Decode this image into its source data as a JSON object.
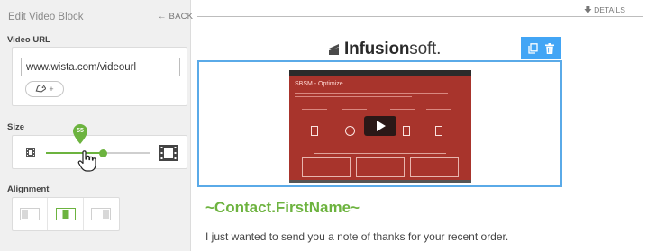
{
  "panel": {
    "title": "Edit Video Block",
    "back_label": "BACK",
    "video_url": {
      "label": "Video URL",
      "value": "www.wista.com/videourl",
      "tag_button_label": "+"
    },
    "size": {
      "label": "Size",
      "slider_value": "55",
      "slider_percent": 0.55
    },
    "alignment": {
      "label": "Alignment",
      "options": [
        "left",
        "center",
        "right"
      ],
      "selected": "center"
    }
  },
  "canvas": {
    "details_label": "DETAILS",
    "logo_text_bold": "Infusion",
    "logo_text_light": "soft.",
    "video": {
      "slide_title": "SBSM - Optimize"
    },
    "headline": "~Contact.FirstName~",
    "body_text": "I just wanted to send you a note of thanks for your recent order."
  },
  "colors": {
    "accent_green": "#6cb33f",
    "selection_blue": "#42a5f5",
    "slide_red": "#a8342c"
  },
  "icons": [
    "back-arrow-icon",
    "tag-icon",
    "film-small-icon",
    "film-large-icon",
    "hand-cursor-icon",
    "align-left-icon",
    "align-center-icon",
    "align-right-icon",
    "details-arrow-icon",
    "infusionsoft-logo-icon",
    "copy-icon",
    "trash-icon",
    "play-icon"
  ]
}
